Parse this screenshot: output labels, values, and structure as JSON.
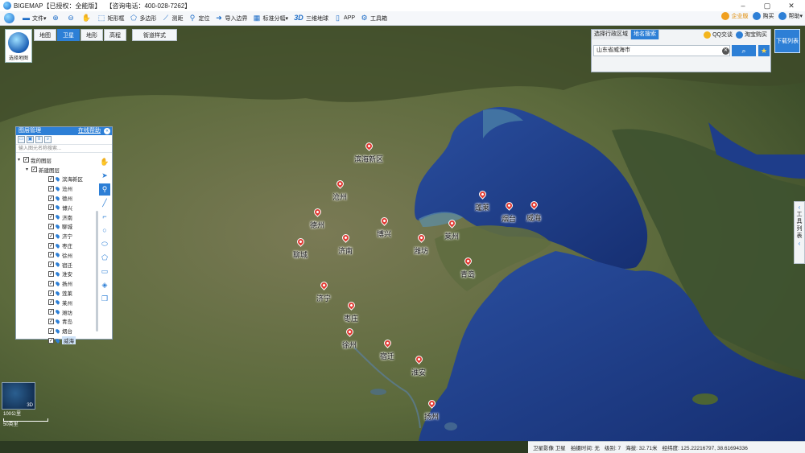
{
  "app": {
    "name": "BIGEMAP",
    "license": "【已授权：全能版】",
    "hotline": "【咨询电话：400-028-7262】"
  },
  "window_controls": {
    "minimize": "–",
    "maximize": "▢",
    "close": "✕"
  },
  "toolbar": {
    "file": "文件",
    "rect_box": "矩形框",
    "polygon": "多边形",
    "measure": "测距",
    "locate": "定位",
    "import_boundary": "导入边界",
    "standard_tiles": "标准分幅",
    "three_d_label": "3D",
    "three_d_globe": "三维地球",
    "app": "APP",
    "toolbox": "工具箱",
    "enterprise": "企业版",
    "buy": "购买",
    "help": "帮助"
  },
  "map_switch": {
    "label": "选择地图"
  },
  "map_types": [
    "地图",
    "卫星",
    "地形",
    "高程"
  ],
  "active_map_type": "卫星",
  "street_style": "街道样式",
  "region_panel": {
    "tabs": [
      "选择行政区域",
      "地名搜索"
    ],
    "active_tab": "地名搜索",
    "qq_chat": "QQ交谈",
    "taobao": "淘宝购买",
    "search_value": "山东省威海市",
    "search_icon": "search-icon",
    "fav_icon": "star-icon"
  },
  "download_list": "下载列表",
  "tool_list": [
    "工",
    "具",
    "列",
    "表"
  ],
  "layer_panel": {
    "title": "图层管理",
    "help": "在线帮助",
    "filter_placeholder": "输入图元名称搜索...",
    "root": "我的图层",
    "folder": "新建图层",
    "items": [
      "滨海新区",
      "沧州",
      "德州",
      "博兴",
      "济南",
      "聊城",
      "济宁",
      "枣庄",
      "徐州",
      "宿迁",
      "淮安",
      "扬州",
      "莲莱",
      "莱州",
      "潍坊",
      "青岛",
      "烟台",
      "威海"
    ],
    "selected": "威海"
  },
  "markers": [
    {
      "name": "滨海新区"
    },
    {
      "name": "沧州"
    },
    {
      "name": "德州"
    },
    {
      "name": "博兴"
    },
    {
      "name": "济南"
    },
    {
      "name": "聊城"
    },
    {
      "name": "潍坊"
    },
    {
      "name": "莱州"
    },
    {
      "name": "蓬莱"
    },
    {
      "name": "烟台"
    },
    {
      "name": "威海"
    },
    {
      "name": "青岛"
    },
    {
      "name": "济宁"
    },
    {
      "name": "枣庄"
    },
    {
      "name": "徐州"
    },
    {
      "name": "宿迁"
    },
    {
      "name": "淮安"
    },
    {
      "name": "扬州"
    }
  ],
  "minimap": {
    "label": "3D"
  },
  "scale": {
    "km": "100公里",
    "mi": "50英里"
  },
  "status": {
    "layer": "卫星影像 卫星",
    "shot_time": "拍摄时间: 无",
    "level": "级别: 7",
    "elevation": "海拔: 32.71米",
    "coords": "经纬度: 125.22216797, 38.61694336"
  },
  "colors": {
    "accent": "#2d7fd6",
    "marker": "#e23b33",
    "sea": "#1e3d8a"
  }
}
